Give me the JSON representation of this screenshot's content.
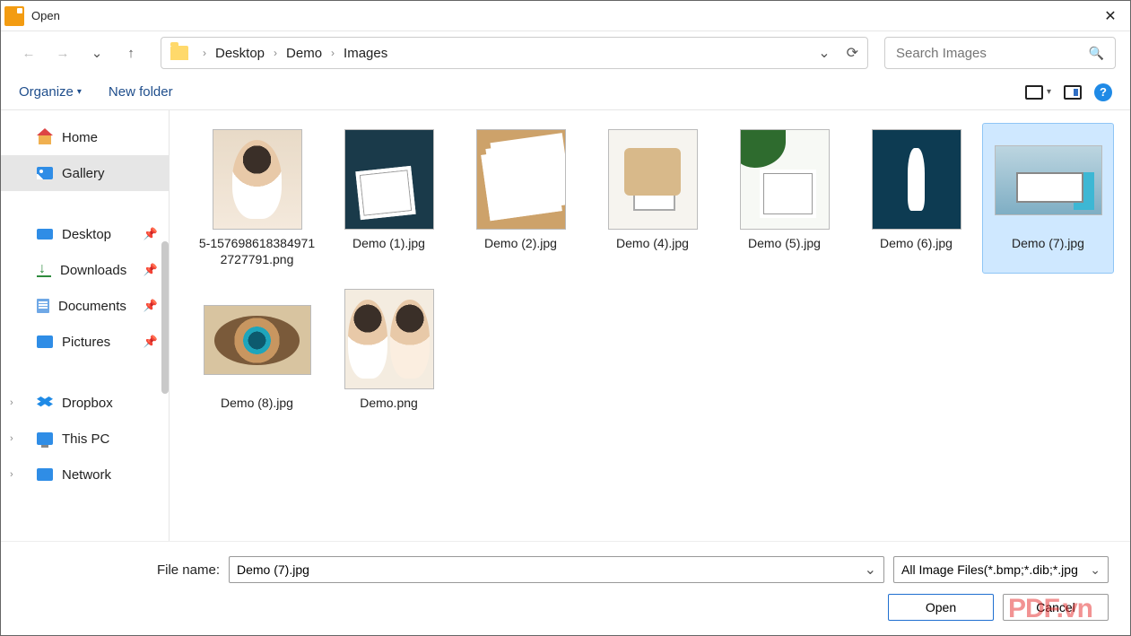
{
  "title": "Open",
  "breadcrumb": [
    "Desktop",
    "Demo",
    "Images"
  ],
  "search_placeholder": "Search Images",
  "toolbar": {
    "organize": "Organize",
    "newfolder": "New folder"
  },
  "sidebar": {
    "home": "Home",
    "gallery": "Gallery",
    "desktop": "Desktop",
    "downloads": "Downloads",
    "documents": "Documents",
    "pictures": "Pictures",
    "dropbox": "Dropbox",
    "thispc": "This PC",
    "network": "Network"
  },
  "files": [
    {
      "name": "5-1576986183849712727791.png",
      "thumb": "t1",
      "wide": false,
      "selected": false
    },
    {
      "name": "Demo (1).jpg",
      "thumb": "t2",
      "wide": false,
      "selected": false
    },
    {
      "name": "Demo (2).jpg",
      "thumb": "t3",
      "wide": false,
      "selected": false
    },
    {
      "name": "Demo (4).jpg",
      "thumb": "t4",
      "wide": false,
      "selected": false
    },
    {
      "name": "Demo (5).jpg",
      "thumb": "t5",
      "wide": false,
      "selected": false
    },
    {
      "name": "Demo (6).jpg",
      "thumb": "t6",
      "wide": false,
      "selected": false
    },
    {
      "name": "Demo (7).jpg",
      "thumb": "t7",
      "wide": true,
      "selected": true
    },
    {
      "name": "Demo (8).jpg",
      "thumb": "t8",
      "wide": true,
      "selected": false
    },
    {
      "name": "Demo.png",
      "thumb": "t9",
      "wide": false,
      "selected": false
    }
  ],
  "filename_label": "File name:",
  "filename_value": "Demo (7).jpg",
  "filter_text": "All Image Files(*.bmp;*.dib;*.jpg",
  "open_btn": "Open",
  "cancel_btn": "Cancel",
  "watermark": "PDF.vn"
}
